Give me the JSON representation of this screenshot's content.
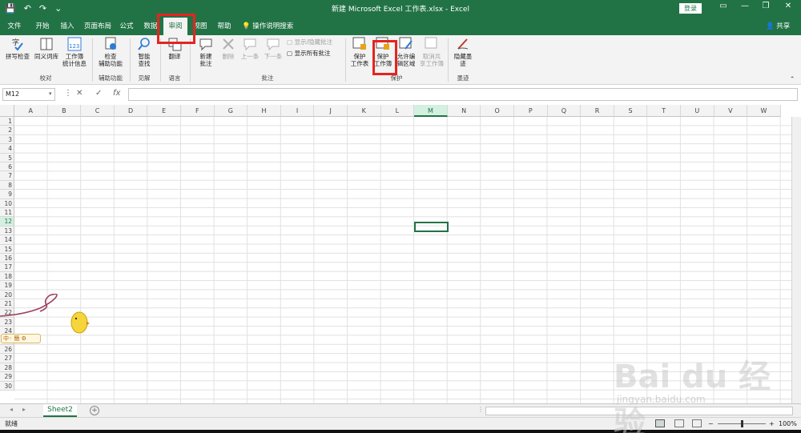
{
  "window": {
    "title": "新建 Microsoft Excel 工作表.xlsx - Excel",
    "login_label": "登录",
    "minimize": "—",
    "restore": "❐",
    "close": "✕",
    "ribbon_opts": "▭"
  },
  "qat": {
    "save": "💾",
    "undo": "↶",
    "redo": "↷",
    "more": "⌄"
  },
  "tabs": {
    "file": "文件",
    "home": "开始",
    "insert": "插入",
    "page_layout": "页面布局",
    "formulas": "公式",
    "data": "数据",
    "review": "审阅",
    "view": "视图",
    "help": "帮助",
    "tell_me": "操作说明搜索",
    "share": "共享"
  },
  "ribbon": {
    "spell_check": "拼写检查",
    "thesaurus": "同义词库",
    "workbook_stats_1": "工作簿",
    "workbook_stats_2": "统计信息",
    "group_proofing": "校对",
    "check_access_1": "检查",
    "check_access_2": "辅助功能",
    "group_accessibility": "辅助功能",
    "smart_lookup_1": "智能",
    "smart_lookup_2": "查找",
    "group_insights": "见解",
    "translate": "翻译",
    "group_language": "语言",
    "new_comment_1": "新建",
    "new_comment_2": "批注",
    "delete": "删除",
    "previous": "上一条",
    "next": "下一条",
    "show_hide_comment": "显示/隐藏批注",
    "show_all_comments": "显示所有批注",
    "group_comments": "批注",
    "protect_sheet_1": "保护",
    "protect_sheet_2": "工作表",
    "protect_workbook_1": "保护",
    "protect_workbook_2": "工作簿",
    "allow_edit_1": "允许编",
    "allow_edit_2": "辑区域",
    "unshare_1": "取消共",
    "unshare_2": "享工作簿",
    "group_protect": "保护",
    "hide_ink_1": "隐藏墨",
    "hide_ink_2": "迹",
    "group_ink": "墨迹"
  },
  "formula_bar": {
    "name_box": "M12",
    "cancel": "✕",
    "enter": "✓",
    "fx": "fx"
  },
  "columns": [
    "A",
    "B",
    "C",
    "D",
    "E",
    "F",
    "G",
    "H",
    "I",
    "J",
    "K",
    "L",
    "M",
    "N",
    "O",
    "P",
    "Q",
    "R",
    "S",
    "T",
    "U",
    "V",
    "W"
  ],
  "rows": [
    "1",
    "2",
    "3",
    "4",
    "5",
    "6",
    "7",
    "8",
    "9",
    "10",
    "11",
    "12",
    "13",
    "14",
    "15",
    "16",
    "17",
    "18",
    "19",
    "20",
    "21",
    "22",
    "23",
    "24",
    "25",
    "26",
    "27",
    "28",
    "29",
    "30"
  ],
  "selected_cell": "M12",
  "sheet_tab": "Sheet2",
  "add_sheet": "+",
  "status": {
    "ready": "就绪",
    "zoom": "100%",
    "zoom_minus": "−",
    "zoom_plus": "+"
  },
  "watermark": {
    "main": "Bai du 经验",
    "url": "jingyan.baidu.com"
  },
  "colors": {
    "excel_green": "#217346",
    "highlight_red": "#e52420"
  }
}
